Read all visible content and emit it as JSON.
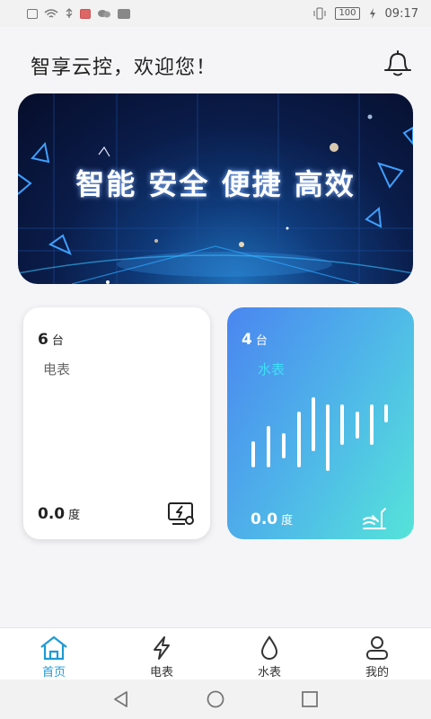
{
  "status_bar": {
    "time": "09:17",
    "battery": "100"
  },
  "header": {
    "greeting": "智享云控，欢迎您！"
  },
  "banner": {
    "slogan": "智能 安全 便捷 高效"
  },
  "cards": {
    "electric": {
      "count": "6",
      "count_unit": "台",
      "label": "电表",
      "reading": "0.0",
      "reading_unit": "度"
    },
    "water": {
      "count": "4",
      "count_unit": "台",
      "label": "水表",
      "reading": "0.0",
      "reading_unit": "度"
    }
  },
  "nav": {
    "home": "首页",
    "electric": "电表",
    "water": "水表",
    "mine": "我的"
  },
  "colors": {
    "accent": "#1e9ad6",
    "water_start": "#4a86f0",
    "water_end": "#55e4d9"
  }
}
